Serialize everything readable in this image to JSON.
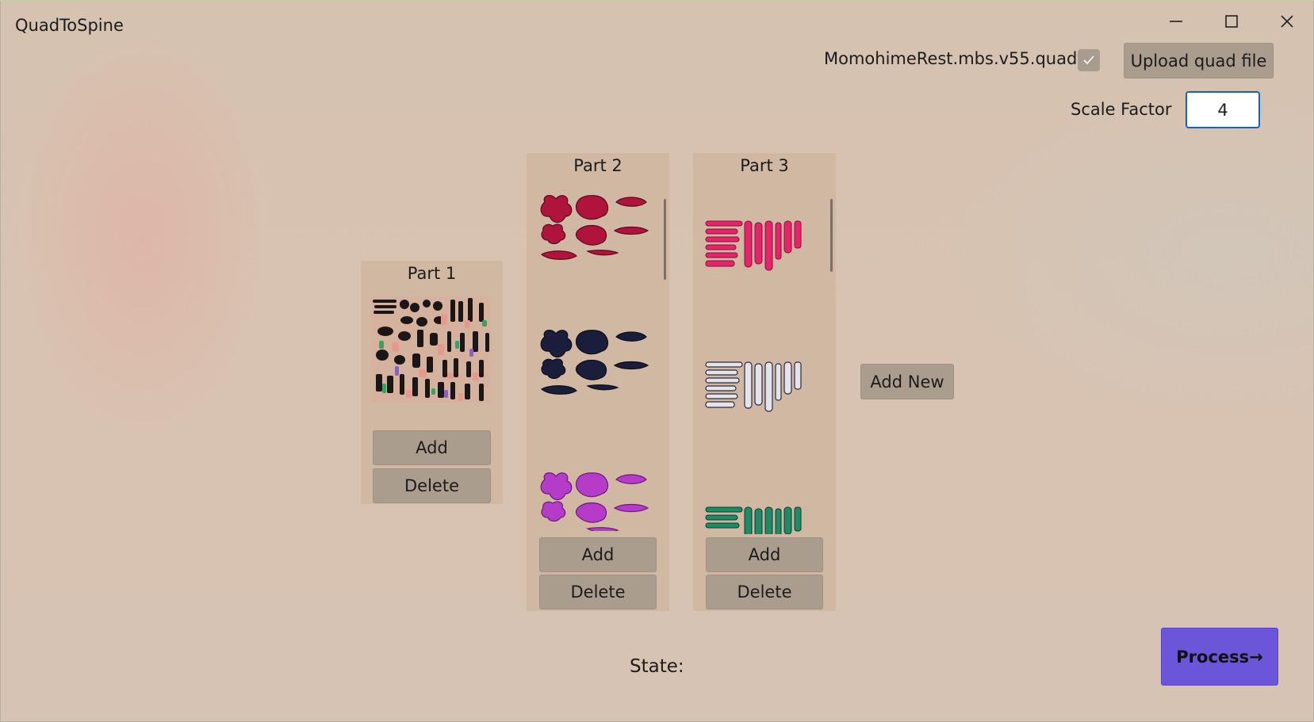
{
  "window": {
    "title": "QuadToSpine",
    "controls": [
      "minimize-icon",
      "maximize-icon",
      "close-icon"
    ]
  },
  "file": {
    "name": "MomohimeRest.mbs.v55.quad",
    "loaded": true,
    "upload_label": "Upload quad file"
  },
  "scale": {
    "label": "Scale Factor",
    "value": "4"
  },
  "parts": [
    {
      "title": "Part 1",
      "add_label": "Add",
      "delete_label": "Delete"
    },
    {
      "title": "Part 2",
      "add_label": "Add",
      "delete_label": "Delete"
    },
    {
      "title": "Part 3",
      "add_label": "Add",
      "delete_label": "Delete"
    }
  ],
  "add_new_label": "Add New",
  "state": {
    "label": "State:",
    "value": ""
  },
  "process_label": "Process→",
  "colors": {
    "accent": "#6b56d9",
    "button": "#aa9d8e",
    "panel": "#d1b8a2",
    "input_border": "#1565b7",
    "atlas_crimson": "#b0143c",
    "atlas_navy": "#1a1e3a",
    "atlas_magenta": "#b43cc8",
    "atlas_pink": "#e5246b",
    "atlas_silver": "#e4e2ea",
    "atlas_green": "#1e8a68"
  }
}
